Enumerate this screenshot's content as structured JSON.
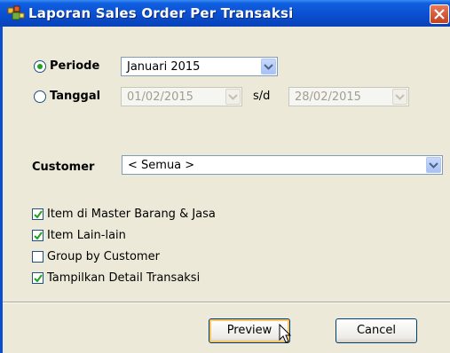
{
  "window": {
    "title": "Laporan Sales Order Per Transaksi"
  },
  "periode": {
    "label": "Periode",
    "selected": true,
    "value": "Januari 2015"
  },
  "tanggal": {
    "label": "Tanggal",
    "selected": false,
    "from": "01/02/2015",
    "separator": "s/d",
    "to": "28/02/2015"
  },
  "customer": {
    "label": "Customer",
    "value": "< Semua >"
  },
  "options": [
    {
      "label": "Item di Master Barang & Jasa",
      "checked": true
    },
    {
      "label": "Item Lain-lain",
      "checked": true
    },
    {
      "label": "Group by Customer",
      "checked": false
    },
    {
      "label": "Tampilkan Detail Transaksi",
      "checked": true
    }
  ],
  "buttons": {
    "preview": "Preview",
    "cancel": "Cancel"
  },
  "colors": {
    "titlebar": "#0a4fd0",
    "close": "#c2401e",
    "radio_dot": "#21a121"
  }
}
